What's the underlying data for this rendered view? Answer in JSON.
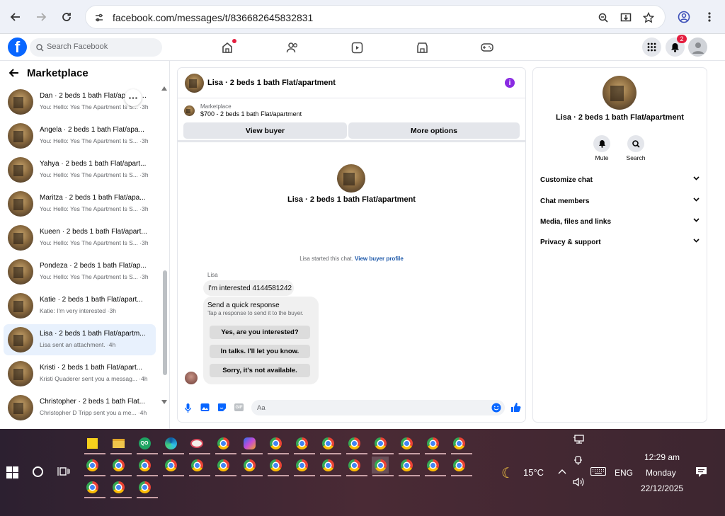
{
  "browser": {
    "url": "facebook.com/messages/t/836682645832831"
  },
  "fb": {
    "search_placeholder": "Search Facebook",
    "notif_count": "2"
  },
  "left": {
    "title": "Marketplace",
    "conversations": [
      {
        "name": "Dan · 2 beds 1 bath Flat/apartment",
        "preview": "You: Hello: Yes The Apartment Is S... ·3h"
      },
      {
        "name": "Angela · 2 beds 1 bath Flat/apa...",
        "preview": "You: Hello: Yes The Apartment Is S... ·3h"
      },
      {
        "name": "Yahya · 2 beds 1 bath Flat/apart...",
        "preview": "You: Hello: Yes The Apartment Is S... ·3h"
      },
      {
        "name": "Maritza · 2 beds 1 bath Flat/apa...",
        "preview": "You: Hello: Yes The Apartment Is S... ·3h"
      },
      {
        "name": "Kueen · 2 beds 1 bath Flat/apart...",
        "preview": "You: Hello: Yes The Apartment Is S... ·3h"
      },
      {
        "name": "Pondeza · 2 beds 1 bath Flat/ap...",
        "preview": "You: Hello: Yes The Apartment Is S... ·3h"
      },
      {
        "name": "Katie · 2 beds 1 bath Flat/apart...",
        "preview": "Katie: I'm very interested ·3h"
      },
      {
        "name": "Lisa · 2 beds 1 bath Flat/apartm...",
        "preview": "Lisa sent an attachment. ·4h"
      },
      {
        "name": "Kristi · 2 beds 1 bath Flat/apart...",
        "preview": "Kristi Quaderer sent you a messag... ·4h"
      },
      {
        "name": "Christopher · 2 beds 1 bath Flat...",
        "preview": "Christopher D Tripp sent you a me... ·4h"
      }
    ]
  },
  "chat": {
    "header_title": "Lisa · 2 beds 1 bath Flat/apartment",
    "marketplace_label": "Marketplace",
    "listing": "$700 - 2 beds 1 bath Flat/apartment",
    "view_buyer": "View buyer",
    "more_options": "More options",
    "profile_name": "Lisa · 2 beds 1 bath Flat/apartment",
    "started_text": "Lisa started this chat.",
    "view_profile_link": "View buyer profile",
    "sender": "Lisa",
    "message": "I'm interested 4144581242",
    "quick_title": "Send a quick response",
    "quick_sub": "Tap a response to send it to the buyer.",
    "quick_replies": [
      "Yes, are you interested?",
      "In talks. I'll let you know.",
      "Sorry, it's not available."
    ],
    "composer_placeholder": "Aa"
  },
  "right": {
    "name": "Lisa · 2 beds 1 bath Flat/apartment",
    "mute": "Mute",
    "search": "Search",
    "sections": [
      "Customize chat",
      "Chat members",
      "Media, files and links",
      "Privacy & support"
    ]
  },
  "taskbar": {
    "weather": "15°C",
    "lang": "ENG",
    "time": "12:29 am",
    "day": "Monday",
    "date": "22/12/2025"
  },
  "colors": {
    "accent": "#0866ff",
    "link": "#1a56a8",
    "badge": "#e41e3f"
  }
}
